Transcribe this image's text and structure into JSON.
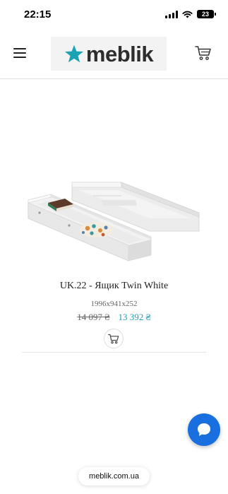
{
  "status_bar": {
    "time": "22:15",
    "battery": "23"
  },
  "header": {
    "brand": "meblik",
    "menu_icon": "hamburger-menu-icon",
    "cart_icon": "shopping-cart-icon",
    "logo_color": "#1ba3b3"
  },
  "product": {
    "title": "UK.22 - Ящик Twin White",
    "dimensions": "1996x941x252",
    "old_price": "14 097 ₴",
    "new_price": "13 392 ₴",
    "price_color": "#1a9eb0",
    "add_to_cart_icon": "cart-icon"
  },
  "chat": {
    "icon": "chat-bubble-icon",
    "color": "#1a6fe0"
  },
  "browser": {
    "url": "meblik.com.ua"
  }
}
